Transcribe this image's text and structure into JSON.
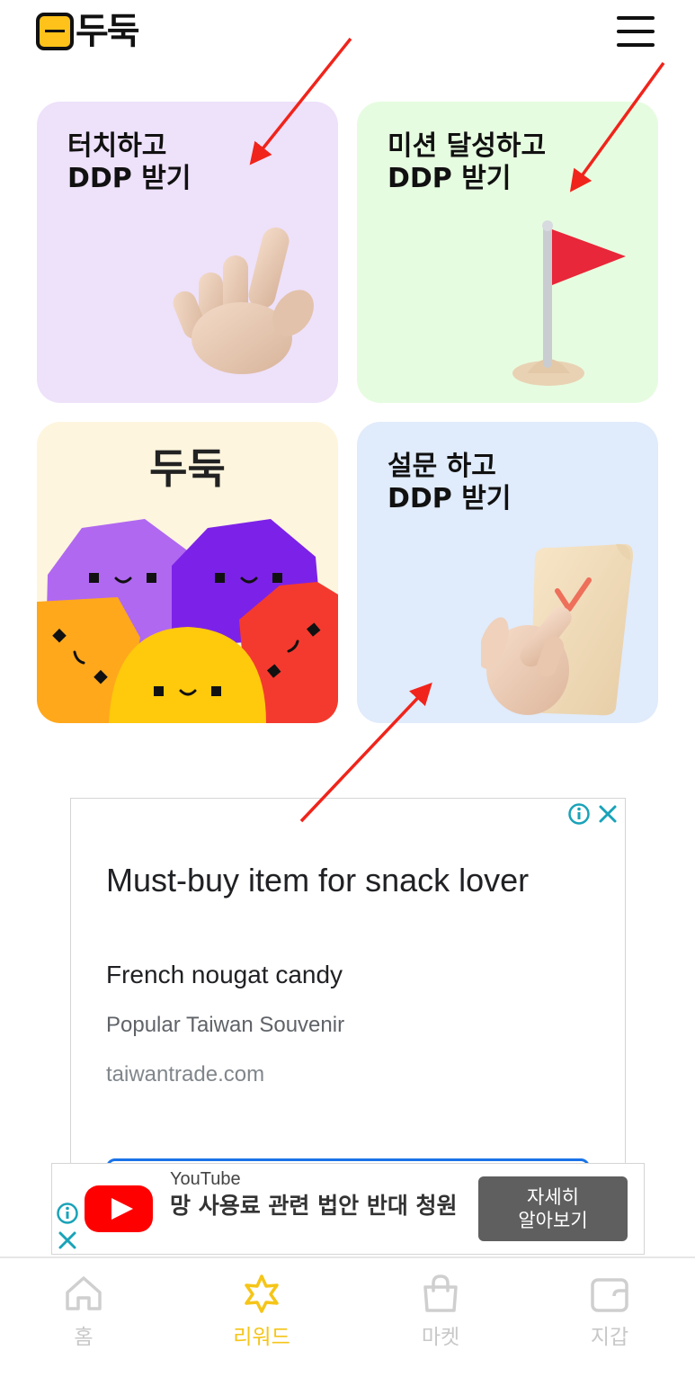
{
  "header": {
    "logo_text": "두둑",
    "menu_icon": "hamburger-menu-icon"
  },
  "cards": {
    "touch": {
      "title": "터치하고\nDDP 받기",
      "icon": "pointing-hand-icon"
    },
    "mission": {
      "title": "미션 달성하고\nDDP 받기",
      "icon": "red-flag-icon"
    },
    "doodook": {
      "title": "두둑",
      "icon": "doodook-characters-icon"
    },
    "survey": {
      "title": "설문 하고\nDDP 받기",
      "icon": "survey-scroll-icon"
    }
  },
  "ad": {
    "headline": "Must-buy item for snack lover",
    "subheadline": "French nougat candy",
    "description": "Popular Taiwan Souvenir",
    "url": "taiwantrade.com"
  },
  "banner_ad": {
    "source": "YouTube",
    "title": "망 사용료 관련 법안 반대 청원",
    "button_label": "자세히\n알아보기"
  },
  "bottom_nav": {
    "items": [
      {
        "label": "홈",
        "icon": "home-icon",
        "active": false
      },
      {
        "label": "리워드",
        "icon": "star-icon",
        "active": true
      },
      {
        "label": "마켓",
        "icon": "shopping-bag-icon",
        "active": false
      },
      {
        "label": "지갑",
        "icon": "wallet-icon",
        "active": false
      }
    ]
  },
  "colors": {
    "accent": "#F5C518",
    "annotation_arrow": "#F0241B",
    "card_touch_bg": "#EEE1FA",
    "card_mission_bg": "#E6FCE0",
    "card_doodook_bg": "#FEF5DF",
    "card_survey_bg": "#E0EBFB"
  }
}
